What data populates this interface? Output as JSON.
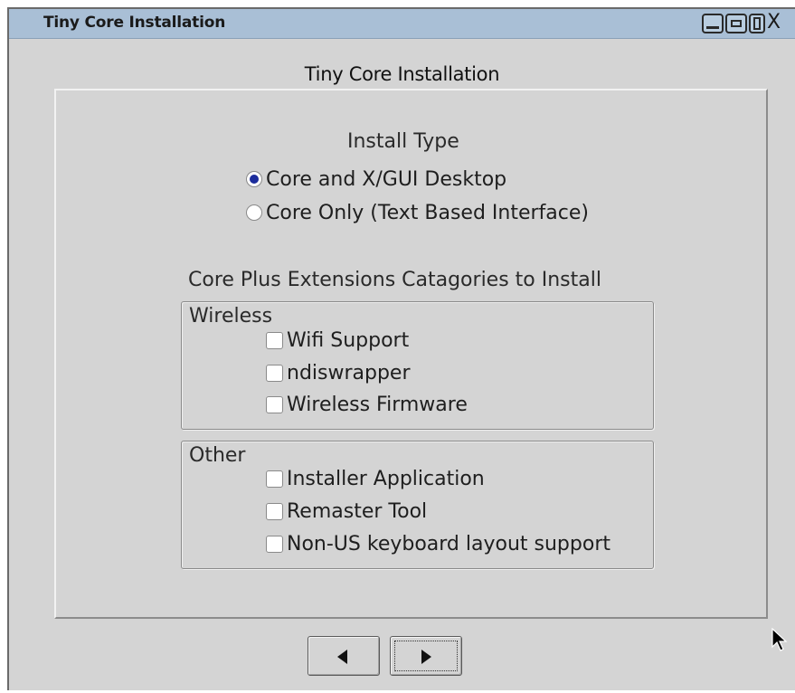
{
  "window": {
    "title": "Tiny Core Installation",
    "controls": {
      "minimize_icon": "minimize-icon",
      "restore_icon": "restore-icon",
      "maximize_icon": "maximize-icon",
      "close_label": "X"
    }
  },
  "dialog": {
    "heading": "Tiny Core Installation",
    "install_type": {
      "label": "Install Type",
      "options": [
        {
          "label": "Core and X/GUI Desktop",
          "selected": true
        },
        {
          "label": "Core Only (Text Based Interface)",
          "selected": false
        }
      ]
    },
    "extensions": {
      "label": "Core Plus Extensions Catagories to Install",
      "groups": [
        {
          "title": "Wireless",
          "items": [
            {
              "label": "Wifi Support",
              "checked": false
            },
            {
              "label": "ndiswrapper",
              "checked": false
            },
            {
              "label": "Wireless Firmware",
              "checked": false
            }
          ]
        },
        {
          "title": "Other",
          "items": [
            {
              "label": "Installer Application",
              "checked": false
            },
            {
              "label": "Remaster Tool",
              "checked": false
            },
            {
              "label": "Non-US keyboard layout support",
              "checked": false
            }
          ]
        }
      ]
    }
  },
  "navigation": {
    "back_icon": "triangle-left-icon",
    "next_icon": "triangle-right-icon"
  },
  "colors": {
    "titlebar": "#a9bfd6",
    "window_bg": "#d4d4d4",
    "radio_selected": "#1c2c9c"
  }
}
